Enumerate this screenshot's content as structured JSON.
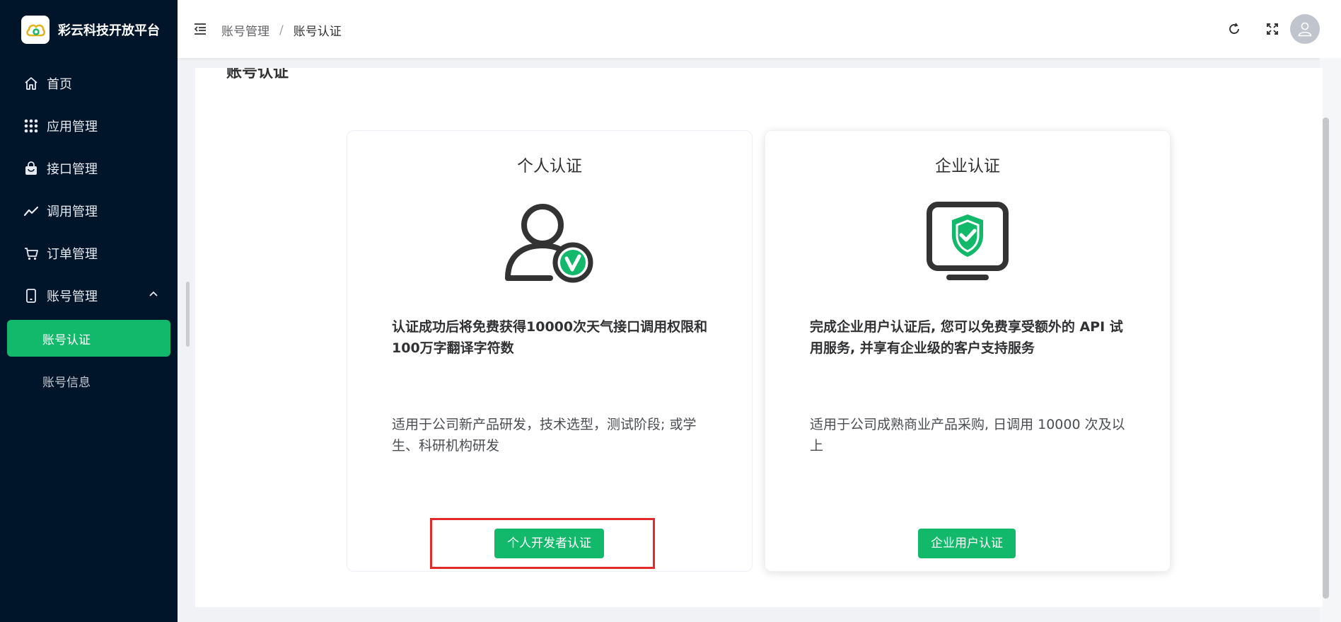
{
  "app": {
    "name": "彩云科技开放平台",
    "accent_color": "#13b96b",
    "sidebar_bg": "#001529"
  },
  "sidebar": {
    "items": [
      {
        "label": "首页",
        "icon": "home-icon"
      },
      {
        "label": "应用管理",
        "icon": "grid-icon"
      },
      {
        "label": "接口管理",
        "icon": "bag-icon"
      },
      {
        "label": "调用管理",
        "icon": "trend-icon"
      },
      {
        "label": "订单管理",
        "icon": "cart-icon"
      },
      {
        "label": "账号管理",
        "icon": "phone-icon",
        "expanded": true
      }
    ],
    "sub_items": [
      {
        "label": "账号认证",
        "active": true
      },
      {
        "label": "账号信息",
        "active": false
      }
    ]
  },
  "header": {
    "breadcrumb": [
      "账号管理",
      "账号认证"
    ],
    "separator": "/"
  },
  "main": {
    "title": "账号认证",
    "cards": [
      {
        "title": "个人认证",
        "icon": "user-check-icon",
        "description": "认证成功后将免费获得10000次天气接口调用权限和100万字翻译字符数",
        "note": "适用于公司新产品研发，技术选型，测试阶段; 或学生、科研机构研发",
        "button": "个人开发者认证"
      },
      {
        "title": "企业认证",
        "icon": "monitor-shield-icon",
        "description": "完成企业用户认证后, 您可以免费享受额外的 API 试用服务, 并享有企业级的客户支持服务",
        "note": "适用于公司成熟商业产品采购, 日调用 10000 次及以上",
        "button": "企业用户认证"
      }
    ]
  }
}
